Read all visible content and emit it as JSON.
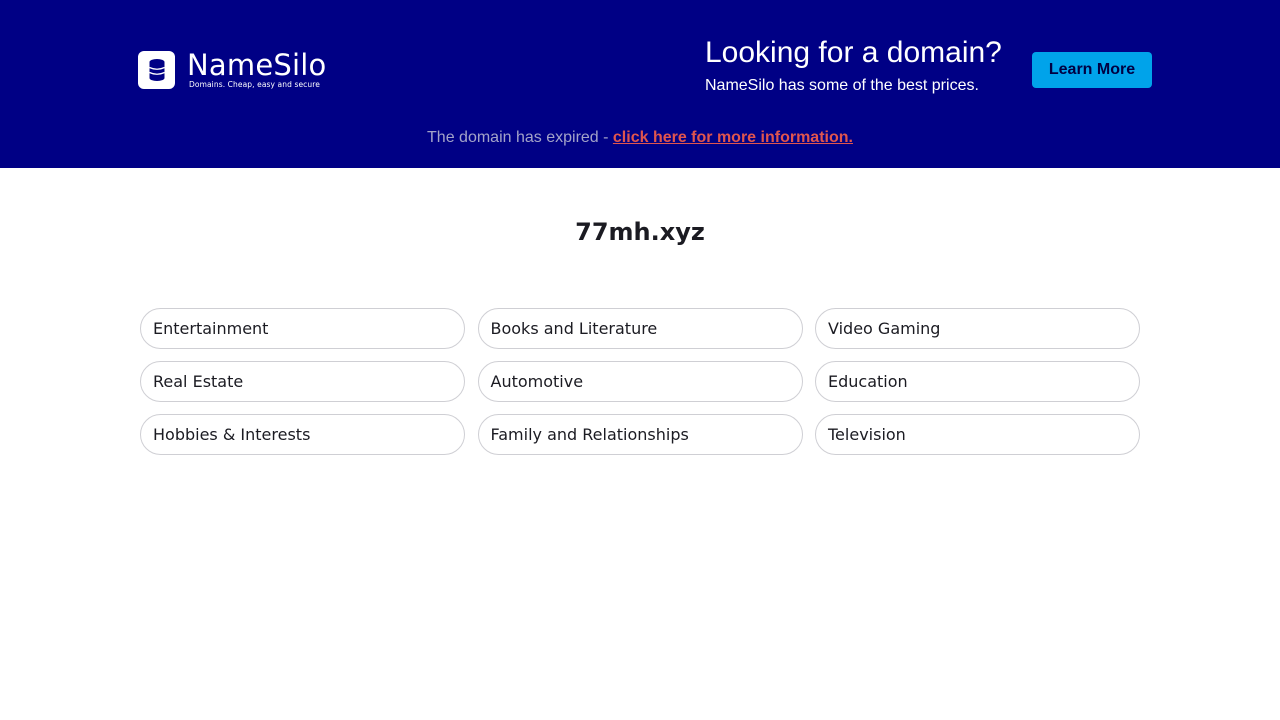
{
  "banner": {
    "logo": {
      "name": "NameSilo",
      "tagline": "Domains. Cheap, easy and secure"
    },
    "promo": {
      "title": "Looking for a domain?",
      "subtitle": "NameSilo has some of the best prices."
    },
    "learn_more_label": "Learn More",
    "expired_text": "The domain has expired - ",
    "expired_link": "click here for more information."
  },
  "domain": "77mh.xyz",
  "categories": [
    "Entertainment",
    "Books and Literature",
    "Video Gaming",
    "Real Estate",
    "Automotive",
    "Education",
    "Hobbies & Interests",
    "Family and Relationships",
    "Television"
  ],
  "colors": {
    "banner_bg": "#000085",
    "button_bg": "#00a3ea",
    "link": "#e0554e"
  }
}
